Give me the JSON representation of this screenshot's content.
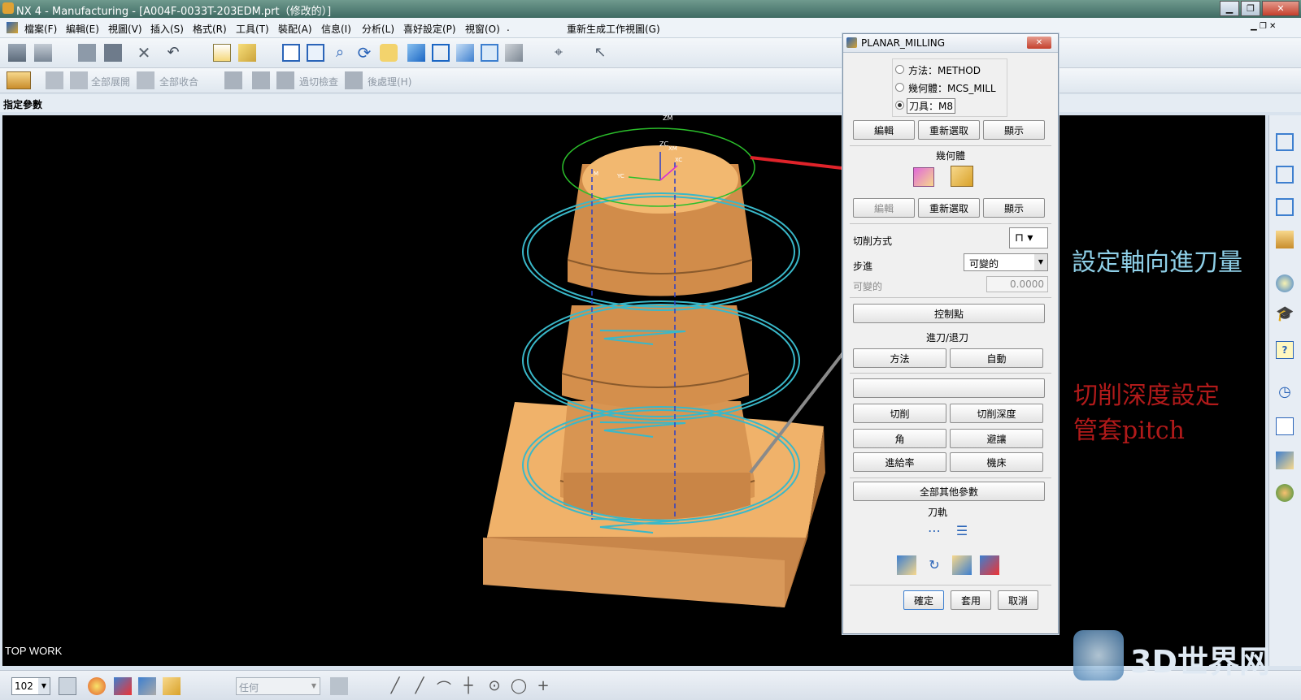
{
  "window": {
    "title": "NX 4 - Manufacturing - [A004F-0033T-203EDM.prt（修改的）]",
    "min": "▁",
    "max": "❐",
    "close": "✕"
  },
  "menu": {
    "items": [
      "檔案(F)",
      "編輯(E)",
      "視圖(V)",
      "插入(S)",
      "格式(R)",
      "工具(T)",
      "裝配(A)",
      "信息(I)",
      "分析(L)",
      "喜好設定(P)",
      "視窗(O)",
      "."
    ],
    "regen": "重新生成工作視圖(G)"
  },
  "toolbar2": {
    "expand_all": "全部展開",
    "collapse_all": "全部收合",
    "overcut_check": "過切檢查",
    "post_process": "後處理(H)"
  },
  "status": {
    "prompt": "指定參數"
  },
  "viewport": {
    "label": "TOP WORK",
    "wcs_labels": {
      "zm": "ZM",
      "zc": "ZC",
      "xm": "XM",
      "xc": "XC",
      "yc": "YC",
      "m": "M"
    }
  },
  "dialog": {
    "title": "PLANAR_MILLING",
    "radios": [
      {
        "label": "方法：METHOD",
        "selected": false
      },
      {
        "label": "幾何體：MCS_MILL",
        "selected": false
      },
      {
        "label": "刀具：M8",
        "selected": true
      }
    ],
    "row1": [
      "編輯",
      "重新選取",
      "顯示"
    ],
    "geometry_title": "幾何體",
    "row2": [
      "編輯",
      "重新選取",
      "顯示"
    ],
    "cut_method_label": "切削方式",
    "step_label": "步進",
    "step_value": "可變的",
    "variable_label": "可變的",
    "variable_value": "0.0000",
    "control_points": "控制點",
    "engage_title": "進刀/退刀",
    "engage_buttons": [
      "方法",
      "自動"
    ],
    "cutting_buttons": [
      "切削",
      "切削深度"
    ],
    "corner_buttons": [
      "角",
      "避讓"
    ],
    "feed_buttons": [
      "進給率",
      "機床"
    ],
    "all_params": "全部其他參數",
    "toolpath_title": "刀軌",
    "footer": [
      "確定",
      "套用",
      "取消"
    ]
  },
  "annotations": {
    "axial_feed": "設定軸向進刀量",
    "depth_line1": "切削深度設定",
    "depth_line2": "管套pitch"
  },
  "bottom": {
    "zoom_value": "102",
    "filter_value": "任何"
  },
  "watermark": {
    "text": "3D世界网"
  },
  "colors": {
    "part": "#f0b26a",
    "part_dark": "#b9783e",
    "toolpath": "#39b8c9",
    "red_box": "#e0232a",
    "gray_box": "#7a7a7a",
    "blue_box": "#9ccfe0",
    "dark_red_box": "#7b1216",
    "annotation_blue": "#8fd0e8",
    "annotation_red": "#b11a1a"
  }
}
